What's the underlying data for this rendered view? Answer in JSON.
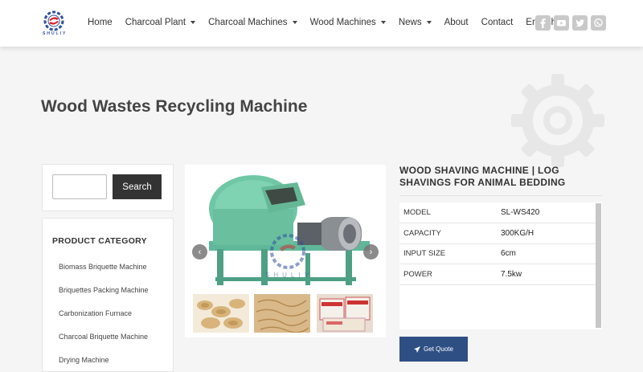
{
  "brand": {
    "logo_text": "SHULIY"
  },
  "nav": {
    "items": [
      {
        "label": "Home",
        "dropdown": false
      },
      {
        "label": "Charcoal Plant",
        "dropdown": true
      },
      {
        "label": "Charcoal Machines",
        "dropdown": true
      },
      {
        "label": "Wood Machines",
        "dropdown": true
      },
      {
        "label": "News",
        "dropdown": true
      },
      {
        "label": "About",
        "dropdown": false
      },
      {
        "label": "Contact",
        "dropdown": false
      },
      {
        "label": "English",
        "dropdown": true
      }
    ]
  },
  "socials": [
    "facebook-icon",
    "youtube-icon",
    "twitter-icon",
    "whatsapp-icon"
  ],
  "page": {
    "title": "Wood Wastes Recycling Machine"
  },
  "search": {
    "button_label": "Search",
    "value": "",
    "placeholder": ""
  },
  "sidebar": {
    "category_title": "PRODUCT CATEGORY",
    "categories": [
      "Biomass Briquette Machine",
      "Briquettes Packing Machine",
      "Carbonization Furnace",
      "Charcoal Briquette Machine",
      "Drying Machine"
    ]
  },
  "product": {
    "title": "WOOD SHAVING MACHINE | LOG SHAVINGS FOR ANIMAL BEDDING",
    "specs": [
      {
        "key": "MODEL",
        "value": "SL-WS420"
      },
      {
        "key": "CAPACITY",
        "value": "300KG/H"
      },
      {
        "key": "INPUT SIZE",
        "value": "6cm"
      },
      {
        "key": "POWER",
        "value": "7.5kw"
      }
    ],
    "quote_label": "Get Quote",
    "watermark_text": "SHULIY"
  },
  "colors": {
    "accent": "#2e4f84",
    "search_button": "#333333",
    "logo_red": "#d8232a",
    "logo_blue": "#2d4fa0"
  }
}
